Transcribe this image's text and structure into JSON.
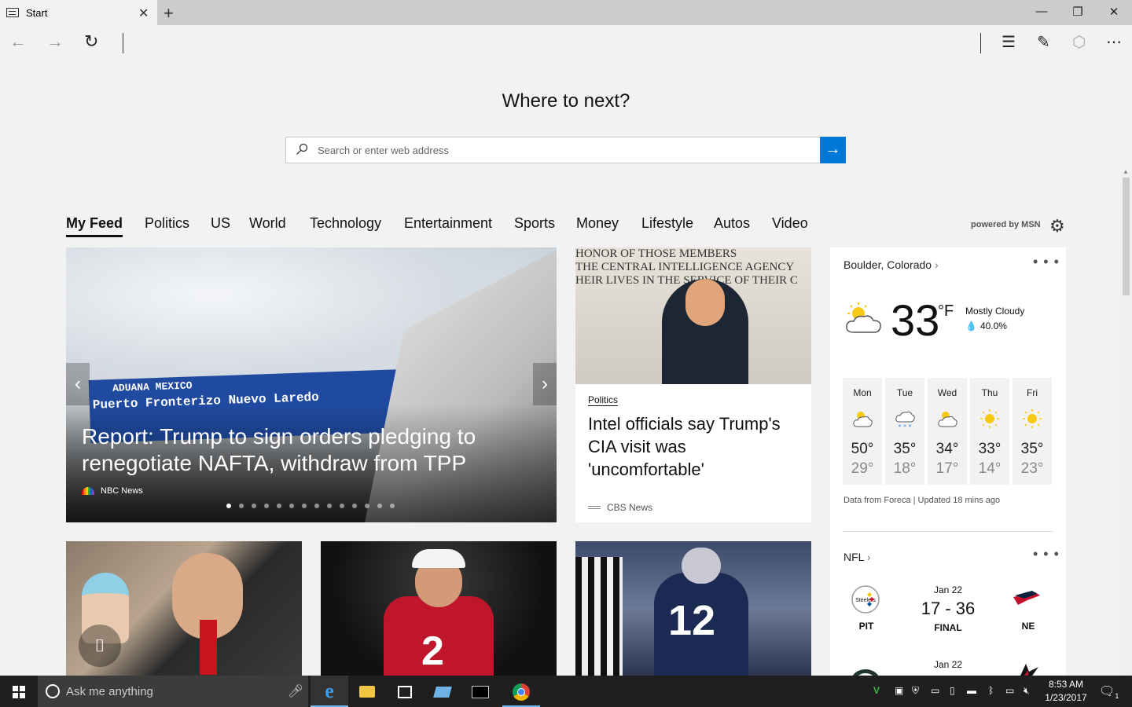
{
  "window": {
    "tab_title": "Start",
    "new_tab": "+",
    "close_tab": "✕",
    "minimize": "—",
    "restore": "❐",
    "close": "✕"
  },
  "navbar": {
    "back": "←",
    "forward": "→",
    "refresh": "↻"
  },
  "start": {
    "heading": "Where to next?",
    "search_placeholder": "Search or enter web address",
    "go": "→"
  },
  "categories": [
    "My Feed",
    "Politics",
    "US",
    "World",
    "Technology",
    "Entertainment",
    "Sports",
    "Money",
    "Lifestyle",
    "Autos",
    "Video"
  ],
  "powered_by": "powered by MSN",
  "hero": {
    "title": "Report: Trump to sign orders pledging to renegotiate NAFTA, withdraw from TPP",
    "source": "NBC News",
    "sign_lines": [
      "ADUANA        MEXICO",
      "Puerto Fronterizo  Nuevo  Laredo"
    ],
    "slides_total": 14,
    "slide_active": 1
  },
  "article2": {
    "wall_text": [
      "HONOR OF THOSE MEMBERS",
      "THE CENTRAL INTELLIGENCE AGENCY",
      "HEIR LIVES IN THE SERVICE OF THEIR C"
    ],
    "category": "Politics",
    "title": "Intel officials say Trump's CIA visit was 'uncomfortable'",
    "source": "CBS News"
  },
  "weather": {
    "location": "Boulder, Colorado",
    "more": "• • •",
    "temp": "33",
    "unit": "°F",
    "condition": "Mostly Cloudy",
    "precip": "40.0%",
    "forecast": [
      {
        "day": "Mon",
        "hi": "50°",
        "lo": "29°",
        "icon": "partly-cloudy"
      },
      {
        "day": "Tue",
        "hi": "35°",
        "lo": "18°",
        "icon": "snow"
      },
      {
        "day": "Wed",
        "hi": "34°",
        "lo": "17°",
        "icon": "partly-cloudy"
      },
      {
        "day": "Thu",
        "hi": "33°",
        "lo": "14°",
        "icon": "sunny"
      },
      {
        "day": "Fri",
        "hi": "35°",
        "lo": "23°",
        "icon": "sunny"
      }
    ],
    "footer": "Data from Foreca | Updated 18 mins ago"
  },
  "nfl": {
    "title": "NFL",
    "more": "• • •",
    "games": [
      {
        "date": "Jan 22",
        "score": "17 - 36",
        "status": "FINAL",
        "home": "PIT",
        "away": "NE"
      },
      {
        "date": "Jan 22",
        "score": "",
        "status": "",
        "home": "",
        "away": ""
      }
    ]
  },
  "thumbs": {
    "t2_number": "2",
    "t3_number": "12"
  },
  "taskbar": {
    "cortana": "Ask me anything",
    "time": "8:53 AM",
    "date": "1/23/2017",
    "notification_count": "1"
  },
  "colors": {
    "accent": "#0078d7",
    "taskbar": "#1f1f1f"
  }
}
